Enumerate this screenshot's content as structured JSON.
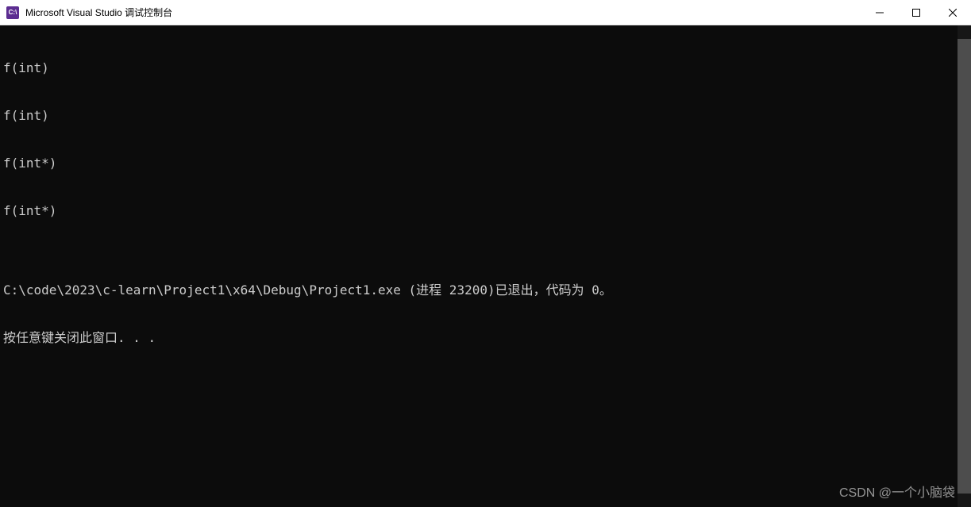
{
  "titlebar": {
    "icon_label": "C:\\",
    "title": "Microsoft Visual Studio 调试控制台"
  },
  "console": {
    "lines": [
      "f(int)",
      "f(int)",
      "f(int*)",
      "f(int*)",
      "",
      "C:\\code\\2023\\c-learn\\Project1\\x64\\Debug\\Project1.exe (进程 23200)已退出，代码为 0。",
      "按任意键关闭此窗口. . ."
    ]
  },
  "watermark": "CSDN @一个小脑袋"
}
